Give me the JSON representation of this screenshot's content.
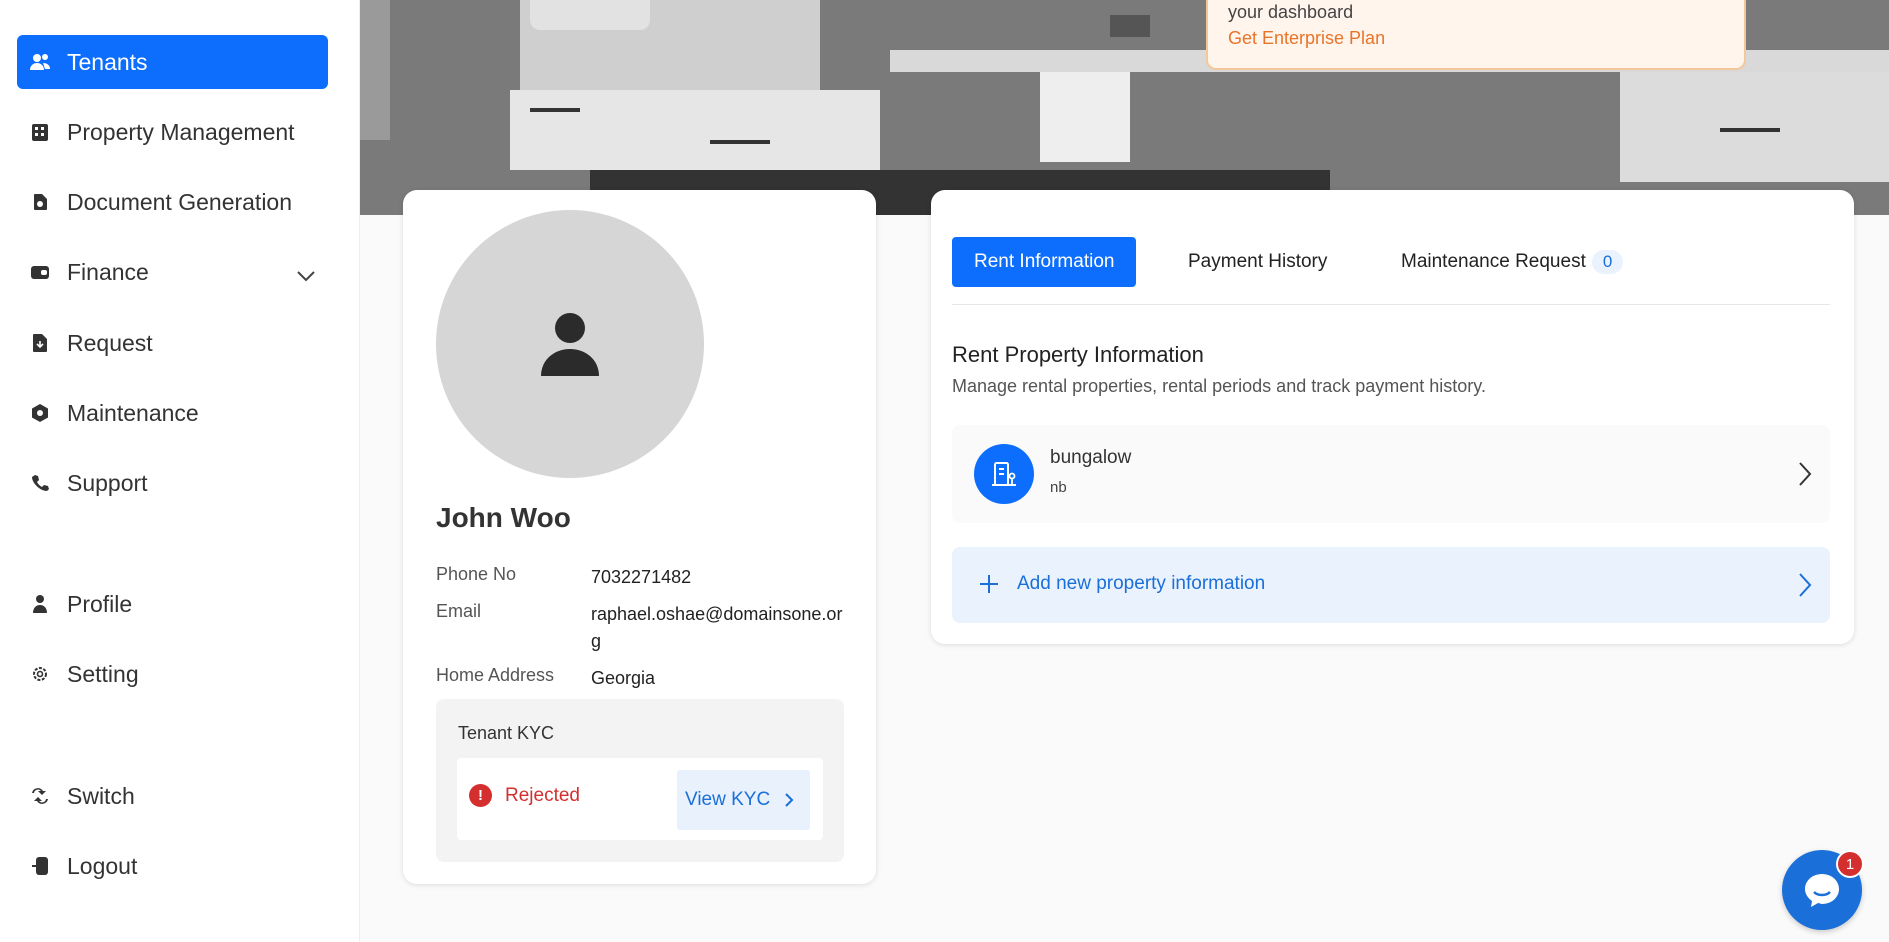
{
  "sidebar": {
    "items": [
      {
        "label": "Tenants",
        "icon": "users-icon",
        "active": true
      },
      {
        "label": "Property Management",
        "icon": "building-icon"
      },
      {
        "label": "Document Generation",
        "icon": "document-icon"
      },
      {
        "label": "Finance",
        "icon": "wallet-icon",
        "expandable": true
      },
      {
        "label": "Request",
        "icon": "request-icon"
      },
      {
        "label": "Maintenance",
        "icon": "maintenance-icon"
      },
      {
        "label": "Support",
        "icon": "phone-icon"
      },
      {
        "label": "Profile",
        "icon": "user-icon"
      },
      {
        "label": "Setting",
        "icon": "gear-icon"
      },
      {
        "label": "Switch",
        "icon": "switch-icon"
      },
      {
        "label": "Logout",
        "icon": "logout-icon"
      }
    ]
  },
  "banner": {
    "upgrade_text": "your dashboard",
    "upgrade_link": "Get Enterprise Plan"
  },
  "tenant": {
    "name": "John Woo",
    "fields": [
      {
        "label": "Phone No",
        "value": "7032271482"
      },
      {
        "label": "Email",
        "value": "raphael.oshae@domainsone.org"
      },
      {
        "label": "Home Address",
        "value": "Georgia"
      }
    ],
    "kyc": {
      "title": "Tenant KYC",
      "status": "Rejected",
      "view_label": "View KYC"
    }
  },
  "rent": {
    "tabs": [
      {
        "label": "Rent Information",
        "active": true
      },
      {
        "label": "Payment History"
      },
      {
        "label": "Maintenance Request",
        "count": "0"
      }
    ],
    "title": "Rent Property Information",
    "description": "Manage rental properties, rental periods and track payment history.",
    "property": {
      "name": "bungalow",
      "sub": "nb"
    },
    "add_label": "Add new property information"
  },
  "chat": {
    "badge": "1"
  },
  "colors": {
    "primary": "#0d6efd",
    "danger": "#d32f2f",
    "accent": "#e8742a"
  }
}
